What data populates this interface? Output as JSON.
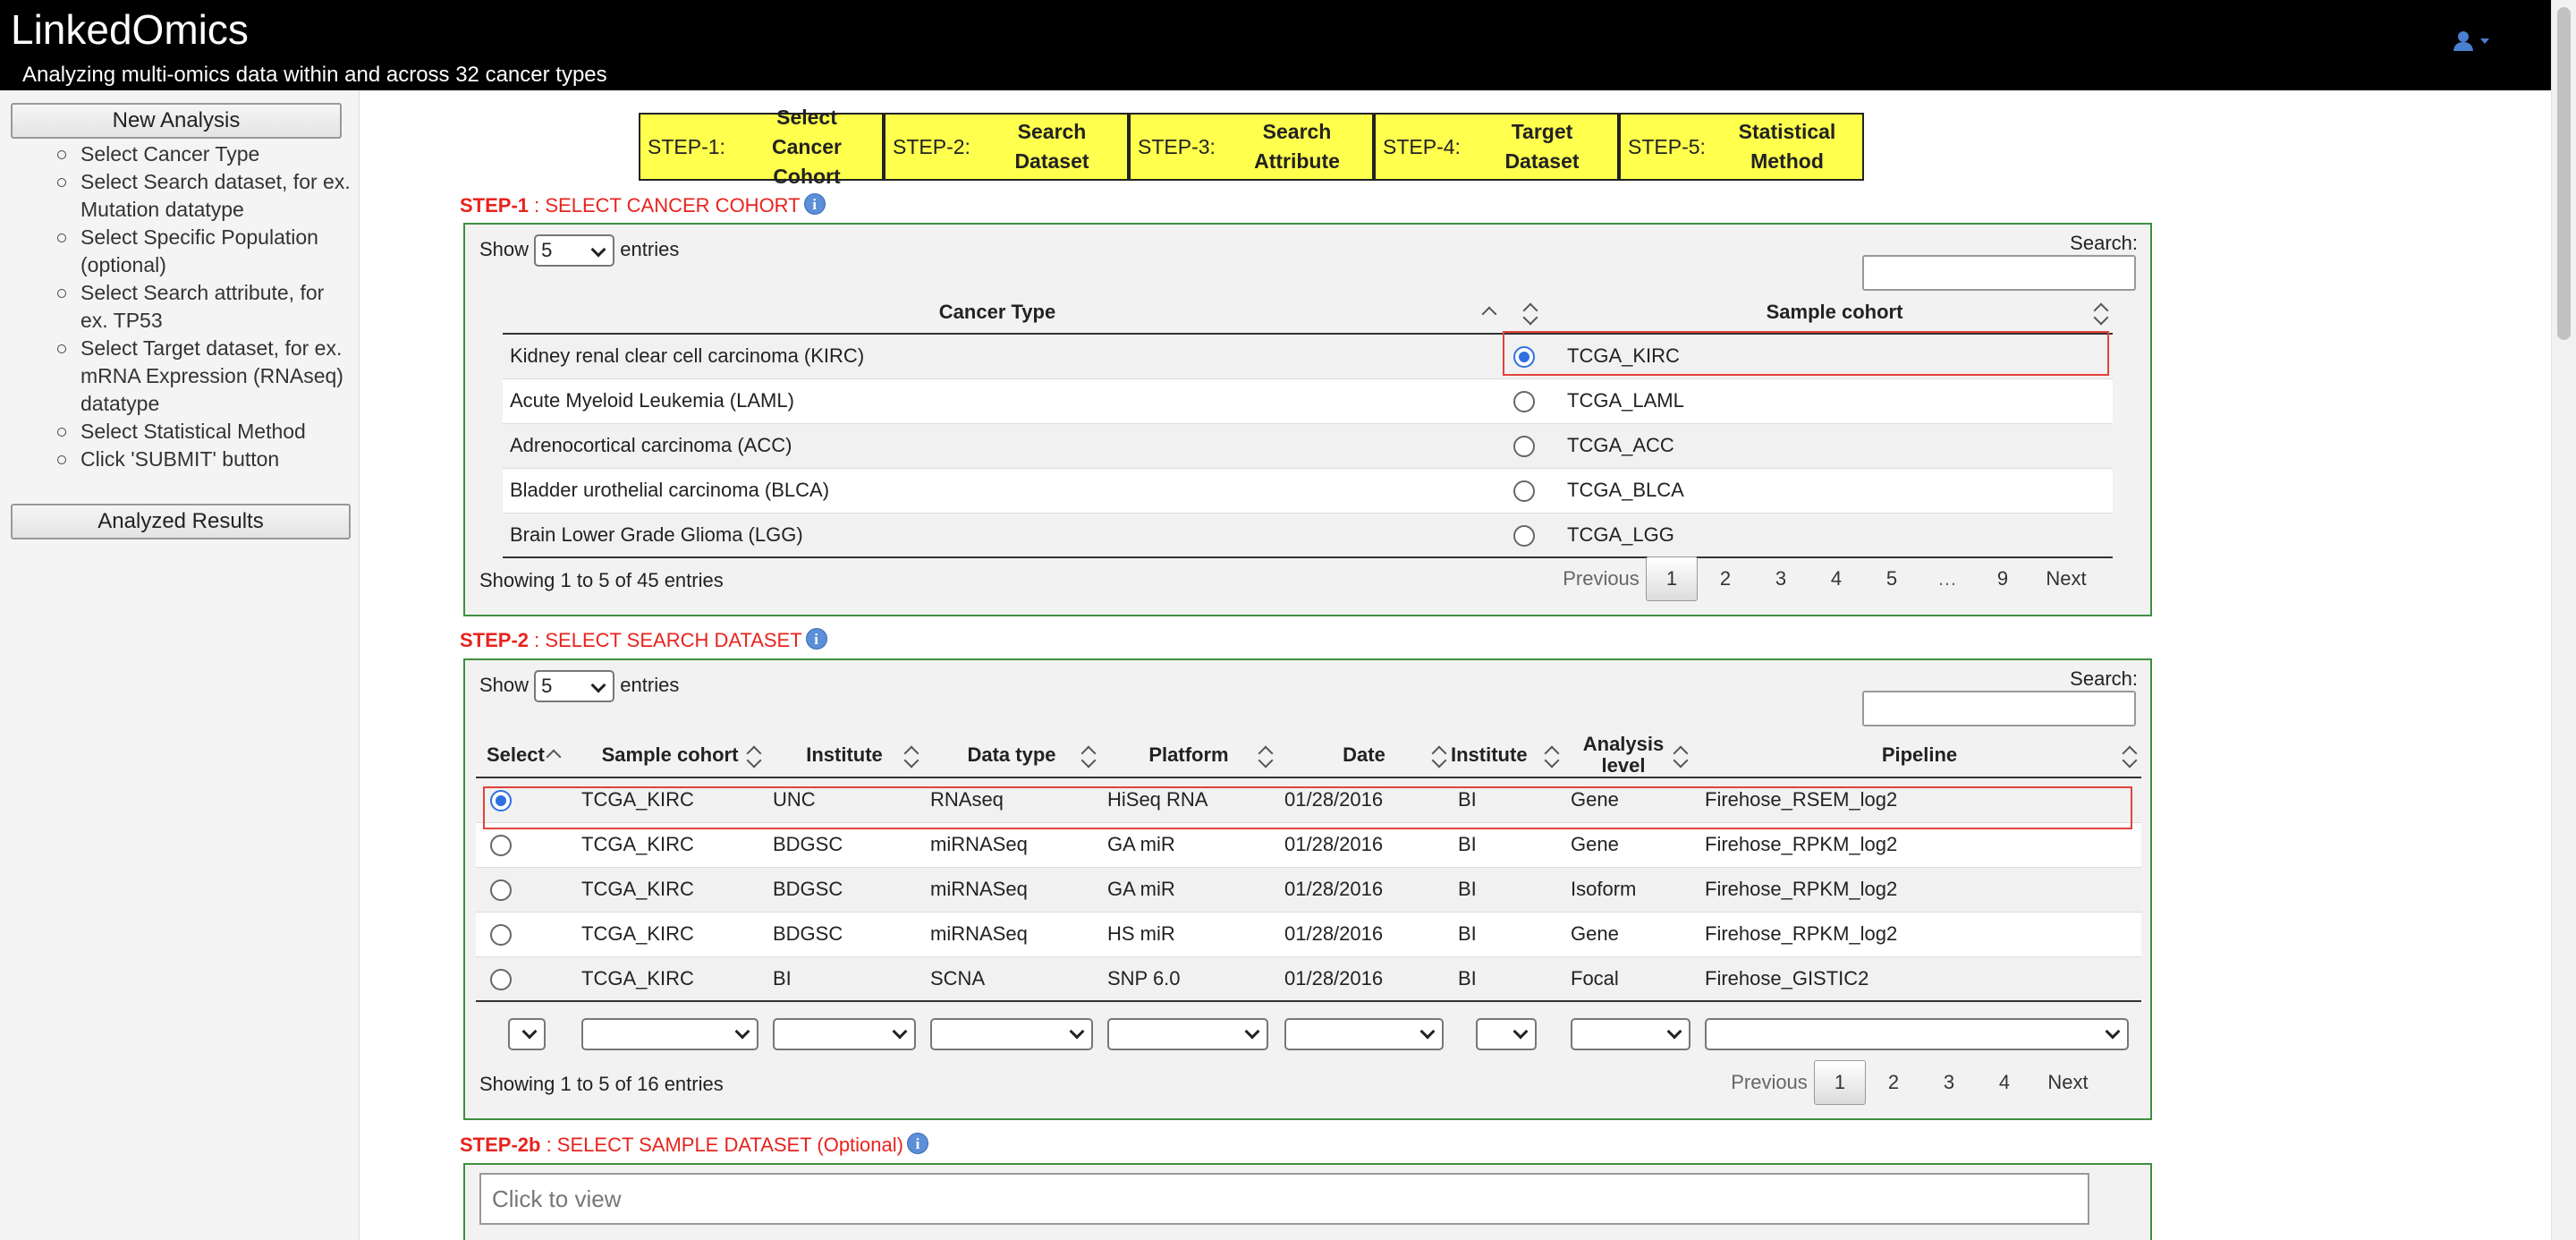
{
  "header": {
    "title": "LinkedOmics",
    "subtitle": "Analyzing multi-omics data within and across 32 cancer types"
  },
  "sidebar": {
    "new_analysis": "New Analysis",
    "analyzed_results": "Analyzed Results",
    "items": [
      "Select Cancer Type",
      "Select Search dataset, for ex. Mutation datatype",
      "Select Specific Population (optional)",
      "Select Search attribute, for ex. TP53",
      "Select Target dataset, for ex. mRNA Expression (RNAseq) datatype",
      "Select Statistical Method",
      "Click 'SUBMIT' button"
    ]
  },
  "steps": [
    {
      "num": "STEP-1:",
      "label": "Select Cancer Cohort"
    },
    {
      "num": "STEP-2:",
      "label": "Search Dataset"
    },
    {
      "num": "STEP-3:",
      "label": "Search Attribute"
    },
    {
      "num": "STEP-4:",
      "label": "Target Dataset"
    },
    {
      "num": "STEP-5:",
      "label": "Statistical Method"
    }
  ],
  "step1": {
    "heading_bold": "STEP-1",
    "heading_text": " : SELECT CANCER COHORT",
    "show": "Show",
    "entries_value": "5",
    "entries": "entries",
    "search_label": "Search:",
    "columns": [
      "Cancer Type",
      "Sample cohort"
    ],
    "rows": [
      {
        "cancer": "Kidney renal clear cell carcinoma (KIRC)",
        "cohort": "TCGA_KIRC",
        "selected": true
      },
      {
        "cancer": "Acute Myeloid Leukemia (LAML)",
        "cohort": "TCGA_LAML",
        "selected": false
      },
      {
        "cancer": "Adrenocortical carcinoma (ACC)",
        "cohort": "TCGA_ACC",
        "selected": false
      },
      {
        "cancer": "Bladder urothelial carcinoma (BLCA)",
        "cohort": "TCGA_BLCA",
        "selected": false
      },
      {
        "cancer": "Brain Lower Grade Glioma (LGG)",
        "cohort": "TCGA_LGG",
        "selected": false
      }
    ],
    "info": "Showing 1 to 5 of 45 entries",
    "pager": [
      "Previous",
      "1",
      "2",
      "3",
      "4",
      "5",
      "…",
      "9",
      "Next"
    ]
  },
  "step2": {
    "heading_bold": "STEP-2",
    "heading_text": " : SELECT SEARCH DATASET",
    "show": "Show",
    "entries_value": "5",
    "entries": "entries",
    "search_label": "Search:",
    "columns": [
      "Select",
      "Sample cohort",
      "Institute",
      "Data type",
      "Platform",
      "Date",
      "Institute",
      "Analysis level",
      "Pipeline"
    ],
    "rows": [
      {
        "cohort": "TCGA_KIRC",
        "inst": "UNC",
        "dtype": "RNAseq",
        "platform": "HiSeq RNA",
        "date": "01/28/2016",
        "inst2": "BI",
        "level": "Gene",
        "pipeline": "Firehose_RSEM_log2",
        "selected": true
      },
      {
        "cohort": "TCGA_KIRC",
        "inst": "BDGSC",
        "dtype": "miRNASeq",
        "platform": "GA miR",
        "date": "01/28/2016",
        "inst2": "BI",
        "level": "Gene",
        "pipeline": "Firehose_RPKM_log2",
        "selected": false
      },
      {
        "cohort": "TCGA_KIRC",
        "inst": "BDGSC",
        "dtype": "miRNASeq",
        "platform": "GA miR",
        "date": "01/28/2016",
        "inst2": "BI",
        "level": "Isoform",
        "pipeline": "Firehose_RPKM_log2",
        "selected": false
      },
      {
        "cohort": "TCGA_KIRC",
        "inst": "BDGSC",
        "dtype": "miRNASeq",
        "platform": "HS miR",
        "date": "01/28/2016",
        "inst2": "BI",
        "level": "Gene",
        "pipeline": "Firehose_RPKM_log2",
        "selected": false
      },
      {
        "cohort": "TCGA_KIRC",
        "inst": "BI",
        "dtype": "SCNA",
        "platform": "SNP 6.0",
        "date": "01/28/2016",
        "inst2": "BI",
        "level": "Focal",
        "pipeline": "Firehose_GISTIC2",
        "selected": false
      }
    ],
    "info": "Showing 1 to 5 of 16 entries",
    "pager": [
      "Previous",
      "1",
      "2",
      "3",
      "4",
      "Next"
    ]
  },
  "step2b": {
    "heading_bold": "STEP-2b",
    "heading_text": " : SELECT SAMPLE DATASET (Optional)",
    "placeholder": "Click to view"
  },
  "colors": {
    "accent_red": "#e8231d",
    "panel_border": "#3f8f3f",
    "step_bg": "#ffff4d"
  }
}
